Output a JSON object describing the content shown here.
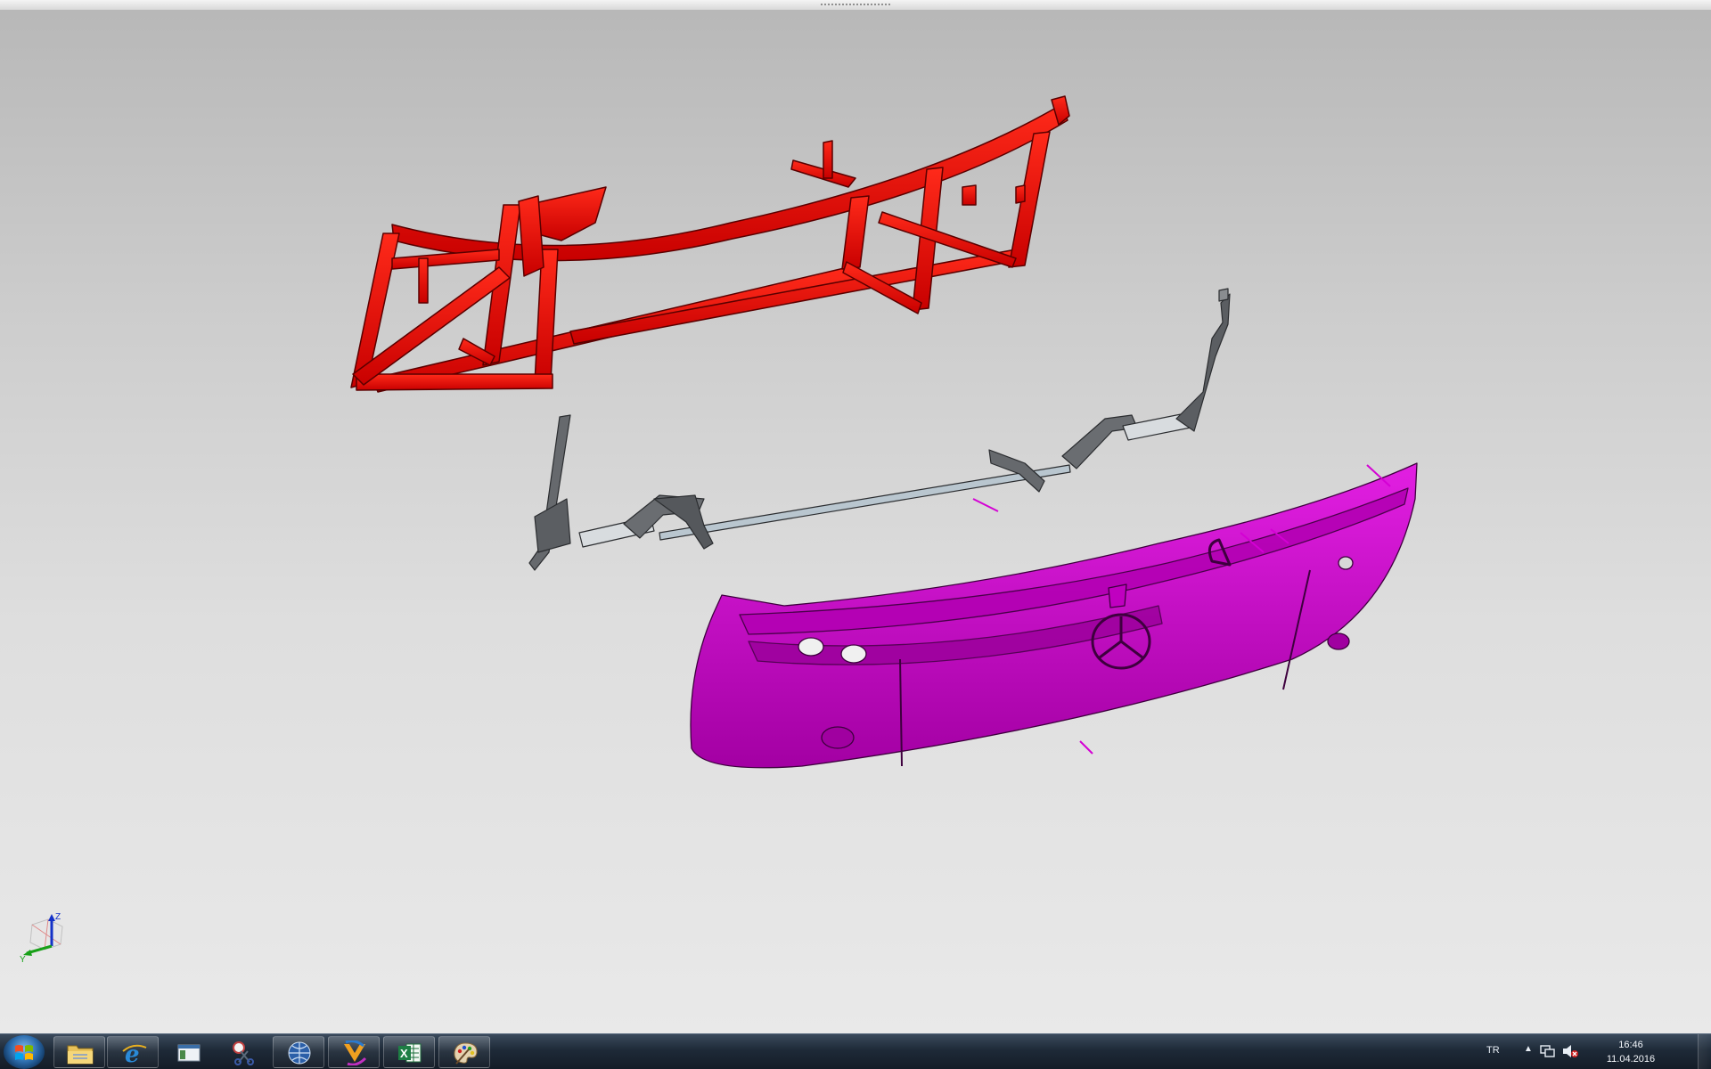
{
  "viewport": {
    "background": "#d6d6d6",
    "parts": {
      "frame": {
        "name": "frame-assembly",
        "color": "#e00000"
      },
      "mechanism": {
        "name": "hinge-mechanism",
        "color": "#5c5f63"
      },
      "bumper": {
        "name": "front-bumper",
        "color": "#c000c0"
      }
    },
    "triad": {
      "x": "Y",
      "z": "Z"
    }
  },
  "taskbar": {
    "apps": [
      {
        "name": "windows-explorer",
        "icon": "folder-icon",
        "active": true
      },
      {
        "name": "internet-explorer",
        "icon": "ie-icon",
        "active": true
      },
      {
        "name": "window-app",
        "icon": "window-icon",
        "active": false
      },
      {
        "name": "snipping-tool",
        "icon": "scissors-icon",
        "active": false
      },
      {
        "name": "globe-app",
        "icon": "globe-icon",
        "active": true
      },
      {
        "name": "nx-cad",
        "icon": "nx-icon",
        "active": true
      },
      {
        "name": "excel",
        "icon": "excel-icon",
        "active": true
      },
      {
        "name": "paint",
        "icon": "palette-icon",
        "active": true
      }
    ],
    "tray": {
      "language": "TR",
      "time": "16:46",
      "date": "11.04.2016"
    }
  }
}
